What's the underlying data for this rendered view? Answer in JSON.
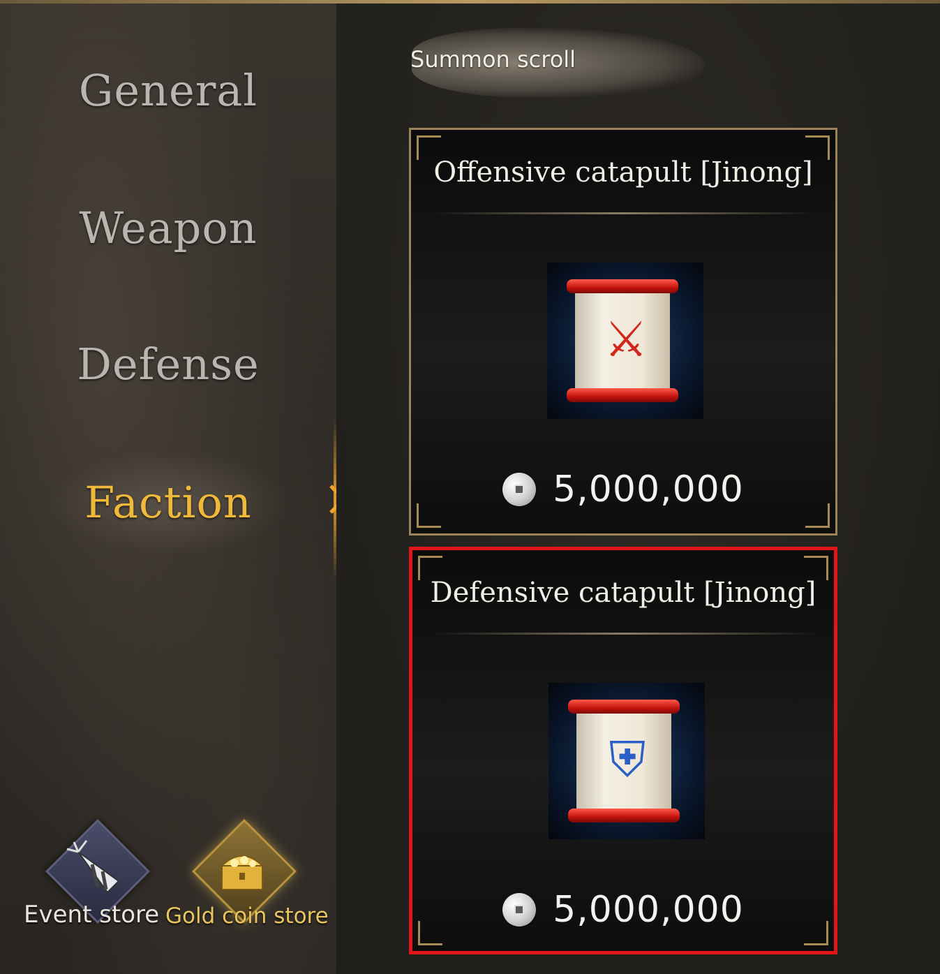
{
  "sidebar": {
    "items": [
      {
        "label": "General"
      },
      {
        "label": "Weapon"
      },
      {
        "label": "Defense"
      },
      {
        "label": "Faction",
        "selected": true
      }
    ],
    "stores": {
      "event_label": "Event store",
      "gold_label": "Gold coin store"
    }
  },
  "main": {
    "section_title": "Summon scroll",
    "items": [
      {
        "name": "Offensive catapult [Jinong]",
        "price": "5,000,000"
      },
      {
        "name": "Defensive catapult [Jinong]",
        "price": "5,000,000",
        "highlighted": true
      }
    ]
  },
  "colors": {
    "selected_tab": "#f0b93a",
    "card_border": "#9c8458",
    "highlight_border": "#e0161a"
  },
  "icons": [
    "party-horn-icon",
    "treasure-chest-icon",
    "silver-coin-icon",
    "chevron-right-icon"
  ]
}
